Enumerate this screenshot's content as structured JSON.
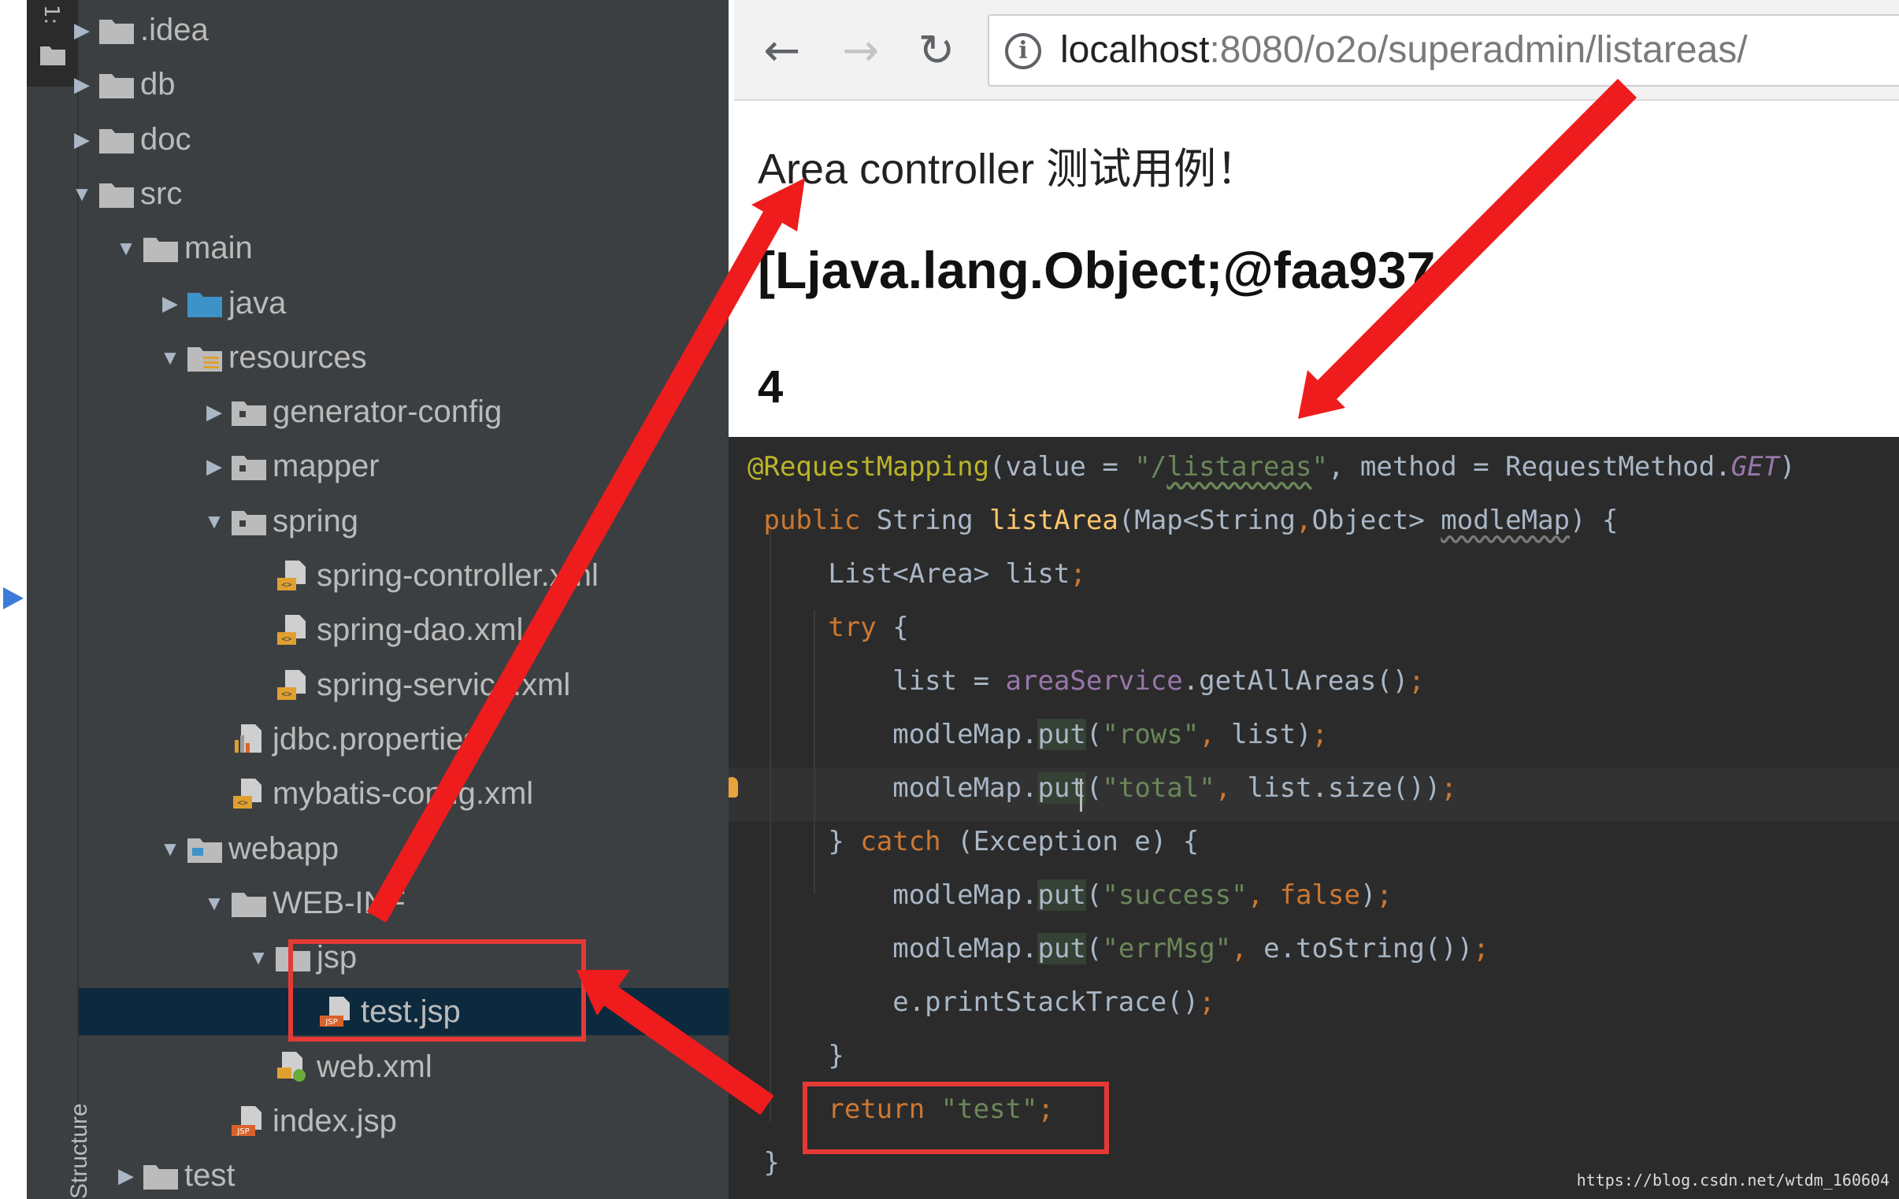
{
  "ide": {
    "side_tab": "1:",
    "structure_tab": "Structure",
    "tree": [
      {
        "label": ".idea",
        "arrow": "▶",
        "icon": "folder-icon"
      },
      {
        "label": "db",
        "arrow": "▶",
        "icon": "folder-icon"
      },
      {
        "label": "doc",
        "arrow": "▶",
        "icon": "folder-icon"
      },
      {
        "label": "src",
        "arrow": "▼",
        "icon": "folder-icon"
      },
      {
        "label": "main",
        "arrow": "▼",
        "icon": "folder-icon"
      },
      {
        "label": "java",
        "arrow": "▶",
        "icon": "source-folder-icon"
      },
      {
        "label": "resources",
        "arrow": "▼",
        "icon": "resources-folder-icon"
      },
      {
        "label": "generator-config",
        "arrow": "▶",
        "icon": "package-folder-icon"
      },
      {
        "label": "mapper",
        "arrow": "▶",
        "icon": "package-folder-icon"
      },
      {
        "label": "spring",
        "arrow": "▼",
        "icon": "package-folder-icon"
      },
      {
        "label": "spring-controller.xml",
        "arrow": "",
        "icon": "xml-file-icon"
      },
      {
        "label": "spring-dao.xml",
        "arrow": "",
        "icon": "xml-file-icon"
      },
      {
        "label": "spring-service.xml",
        "arrow": "",
        "icon": "xml-file-icon"
      },
      {
        "label": "jdbc.properties",
        "arrow": "",
        "icon": "properties-file-icon"
      },
      {
        "label": "mybatis-config.xml",
        "arrow": "",
        "icon": "xml-file-icon"
      },
      {
        "label": "webapp",
        "arrow": "▼",
        "icon": "web-folder-icon"
      },
      {
        "label": "WEB-INF",
        "arrow": "▼",
        "icon": "folder-icon"
      },
      {
        "label": "jsp",
        "arrow": "▼",
        "icon": "folder-icon"
      },
      {
        "label": "test.jsp",
        "arrow": "",
        "icon": "jsp-file-icon",
        "selected": true
      },
      {
        "label": "web.xml",
        "arrow": "",
        "icon": "web-xml-file-icon"
      },
      {
        "label": "index.jsp",
        "arrow": "",
        "icon": "jsp-file-icon"
      },
      {
        "label": "test",
        "arrow": "▶",
        "icon": "folder-icon"
      }
    ],
    "file_badges": {
      "xml": "<>",
      "jsp": "JSP"
    }
  },
  "browser": {
    "back": "←",
    "forward": "→",
    "reload": "↻",
    "info": "i",
    "url_host": "localhost",
    "url_rest": ":8080/o2o/superadmin/listareas/",
    "heading": "Area controller 测试用例！",
    "object_text": "[Ljava.lang.Object;@faa937",
    "count": "4"
  },
  "code": {
    "lines": [
      [
        {
          "t": "@RequestMapping",
          "c": "t-ann"
        },
        {
          "t": "(value = ",
          "c": "t-plain"
        },
        {
          "t": "\"/",
          "c": "t-str"
        },
        {
          "t": "listareas",
          "c": "t-str t-wavy"
        },
        {
          "t": "\"",
          "c": "t-str"
        },
        {
          "t": ", method = RequestMethod.",
          "c": "t-plain"
        },
        {
          "t": "GET",
          "c": "t-ital"
        },
        {
          "t": ")",
          "c": "t-plain"
        }
      ],
      [
        {
          "t": " public ",
          "c": "t-kw"
        },
        {
          "t": "String ",
          "c": "t-plain"
        },
        {
          "t": "listArea",
          "c": "t-fn"
        },
        {
          "t": "(Map<String",
          "c": "t-plain"
        },
        {
          "t": ",",
          "c": "t-kw"
        },
        {
          "t": "Object> ",
          "c": "t-plain"
        },
        {
          "t": "modleMap",
          "c": "t-plain t-wavy2"
        },
        {
          "t": ") {",
          "c": "t-plain"
        }
      ],
      [
        {
          "t": "     List<Area> list",
          "c": "t-plain"
        },
        {
          "t": ";",
          "c": "t-kw"
        }
      ],
      [
        {
          "t": "     try ",
          "c": "t-kw"
        },
        {
          "t": "{",
          "c": "t-plain"
        }
      ],
      [
        {
          "t": "         list = ",
          "c": "t-plain"
        },
        {
          "t": "areaService",
          "c": "t-fld"
        },
        {
          "t": ".getAllAreas()",
          "c": "t-plain"
        },
        {
          "t": ";",
          "c": "t-kw"
        }
      ],
      [
        {
          "t": "         modleMap.",
          "c": "t-plain"
        },
        {
          "t": "put",
          "c": "t-plain t-hl"
        },
        {
          "t": "(",
          "c": "t-plain"
        },
        {
          "t": "\"rows\"",
          "c": "t-str"
        },
        {
          "t": ", ",
          "c": "t-kw"
        },
        {
          "t": "list)",
          "c": "t-plain"
        },
        {
          "t": ";",
          "c": "t-kw"
        }
      ],
      [
        {
          "t": "         modleMap.",
          "c": "t-plain"
        },
        {
          "t": "put",
          "c": "t-plain t-hl"
        },
        {
          "t": "(",
          "c": "t-plain"
        },
        {
          "t": "\"total\"",
          "c": "t-str"
        },
        {
          "t": ", ",
          "c": "t-kw"
        },
        {
          "t": "list.size())",
          "c": "t-plain"
        },
        {
          "t": ";",
          "c": "t-kw"
        }
      ],
      [
        {
          "t": "     } ",
          "c": "t-plain"
        },
        {
          "t": "catch ",
          "c": "t-kw"
        },
        {
          "t": "(Exception e) {",
          "c": "t-plain"
        }
      ],
      [
        {
          "t": "         modleMap.",
          "c": "t-plain"
        },
        {
          "t": "put",
          "c": "t-plain t-hl"
        },
        {
          "t": "(",
          "c": "t-plain"
        },
        {
          "t": "\"success\"",
          "c": "t-str"
        },
        {
          "t": ", ",
          "c": "t-kw"
        },
        {
          "t": "false",
          "c": "t-kw"
        },
        {
          "t": ")",
          "c": "t-plain"
        },
        {
          "t": ";",
          "c": "t-kw"
        }
      ],
      [
        {
          "t": "         modleMap.",
          "c": "t-plain"
        },
        {
          "t": "put",
          "c": "t-plain t-hl"
        },
        {
          "t": "(",
          "c": "t-plain"
        },
        {
          "t": "\"errMsg\"",
          "c": "t-str"
        },
        {
          "t": ", ",
          "c": "t-kw"
        },
        {
          "t": "e.toString())",
          "c": "t-plain"
        },
        {
          "t": ";",
          "c": "t-kw"
        }
      ],
      [
        {
          "t": "         e.printStackTrace()",
          "c": "t-plain"
        },
        {
          "t": ";",
          "c": "t-kw"
        }
      ],
      [
        {
          "t": "     }",
          "c": "t-plain"
        }
      ],
      [
        {
          "t": "     return ",
          "c": "t-kw"
        },
        {
          "t": "\"test\"",
          "c": "t-str"
        },
        {
          "t": ";",
          "c": "t-kw"
        }
      ],
      [
        {
          "t": " }",
          "c": "t-plain"
        }
      ]
    ],
    "watermark": "https://blog.csdn.net/wtdm_160604"
  },
  "colors": {
    "annotation_red": "#e53935",
    "ide_background": "#3c3f41",
    "editor_background": "#2b2b2b",
    "selection": "#0d293e"
  }
}
